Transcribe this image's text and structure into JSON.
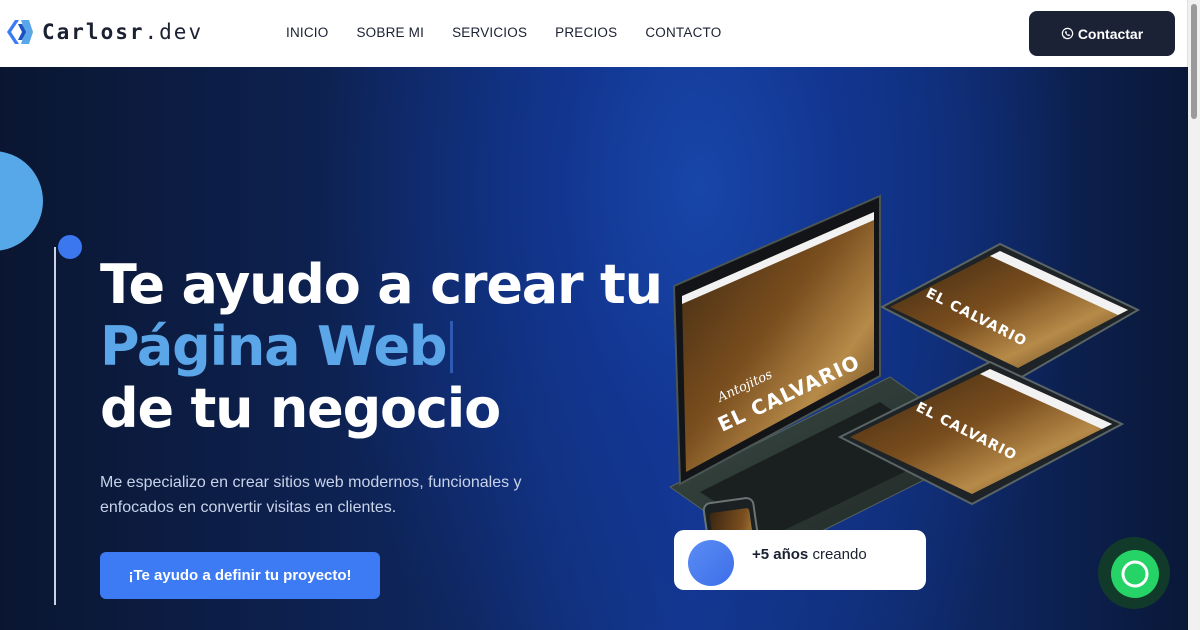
{
  "navbar": {
    "logo_name": "Carlosr",
    "logo_domain": ".dev",
    "links": [
      "INICIO",
      "SOBRE MI",
      "SERVICIOS",
      "PRECIOS",
      "CONTACTO"
    ],
    "contact_label": "Contactar"
  },
  "hero": {
    "headline_line1": "Te ayudo a crear tu",
    "headline_line2": "Página Web",
    "headline_line3": "de tu negocio",
    "subtext": "Me especializo en crear sitios web modernos, funcionales y enfocados en convertir visitas en clientes.",
    "cta_label": "¡Te ayudo a definir tu proyecto!",
    "mockup_brand_small": "Antojitos",
    "mockup_brand_main": "EL CALVARIO",
    "stat_strong": "+5 años",
    "stat_rest": " creando"
  },
  "colors": {
    "accent": "#3d7bf4",
    "highlight": "#5aa6e8",
    "nav_button": "#1b2236",
    "whatsapp": "#25d366"
  },
  "icons": [
    "logo-mark-icon",
    "whatsapp-icon",
    "whatsapp-float-icon"
  ]
}
